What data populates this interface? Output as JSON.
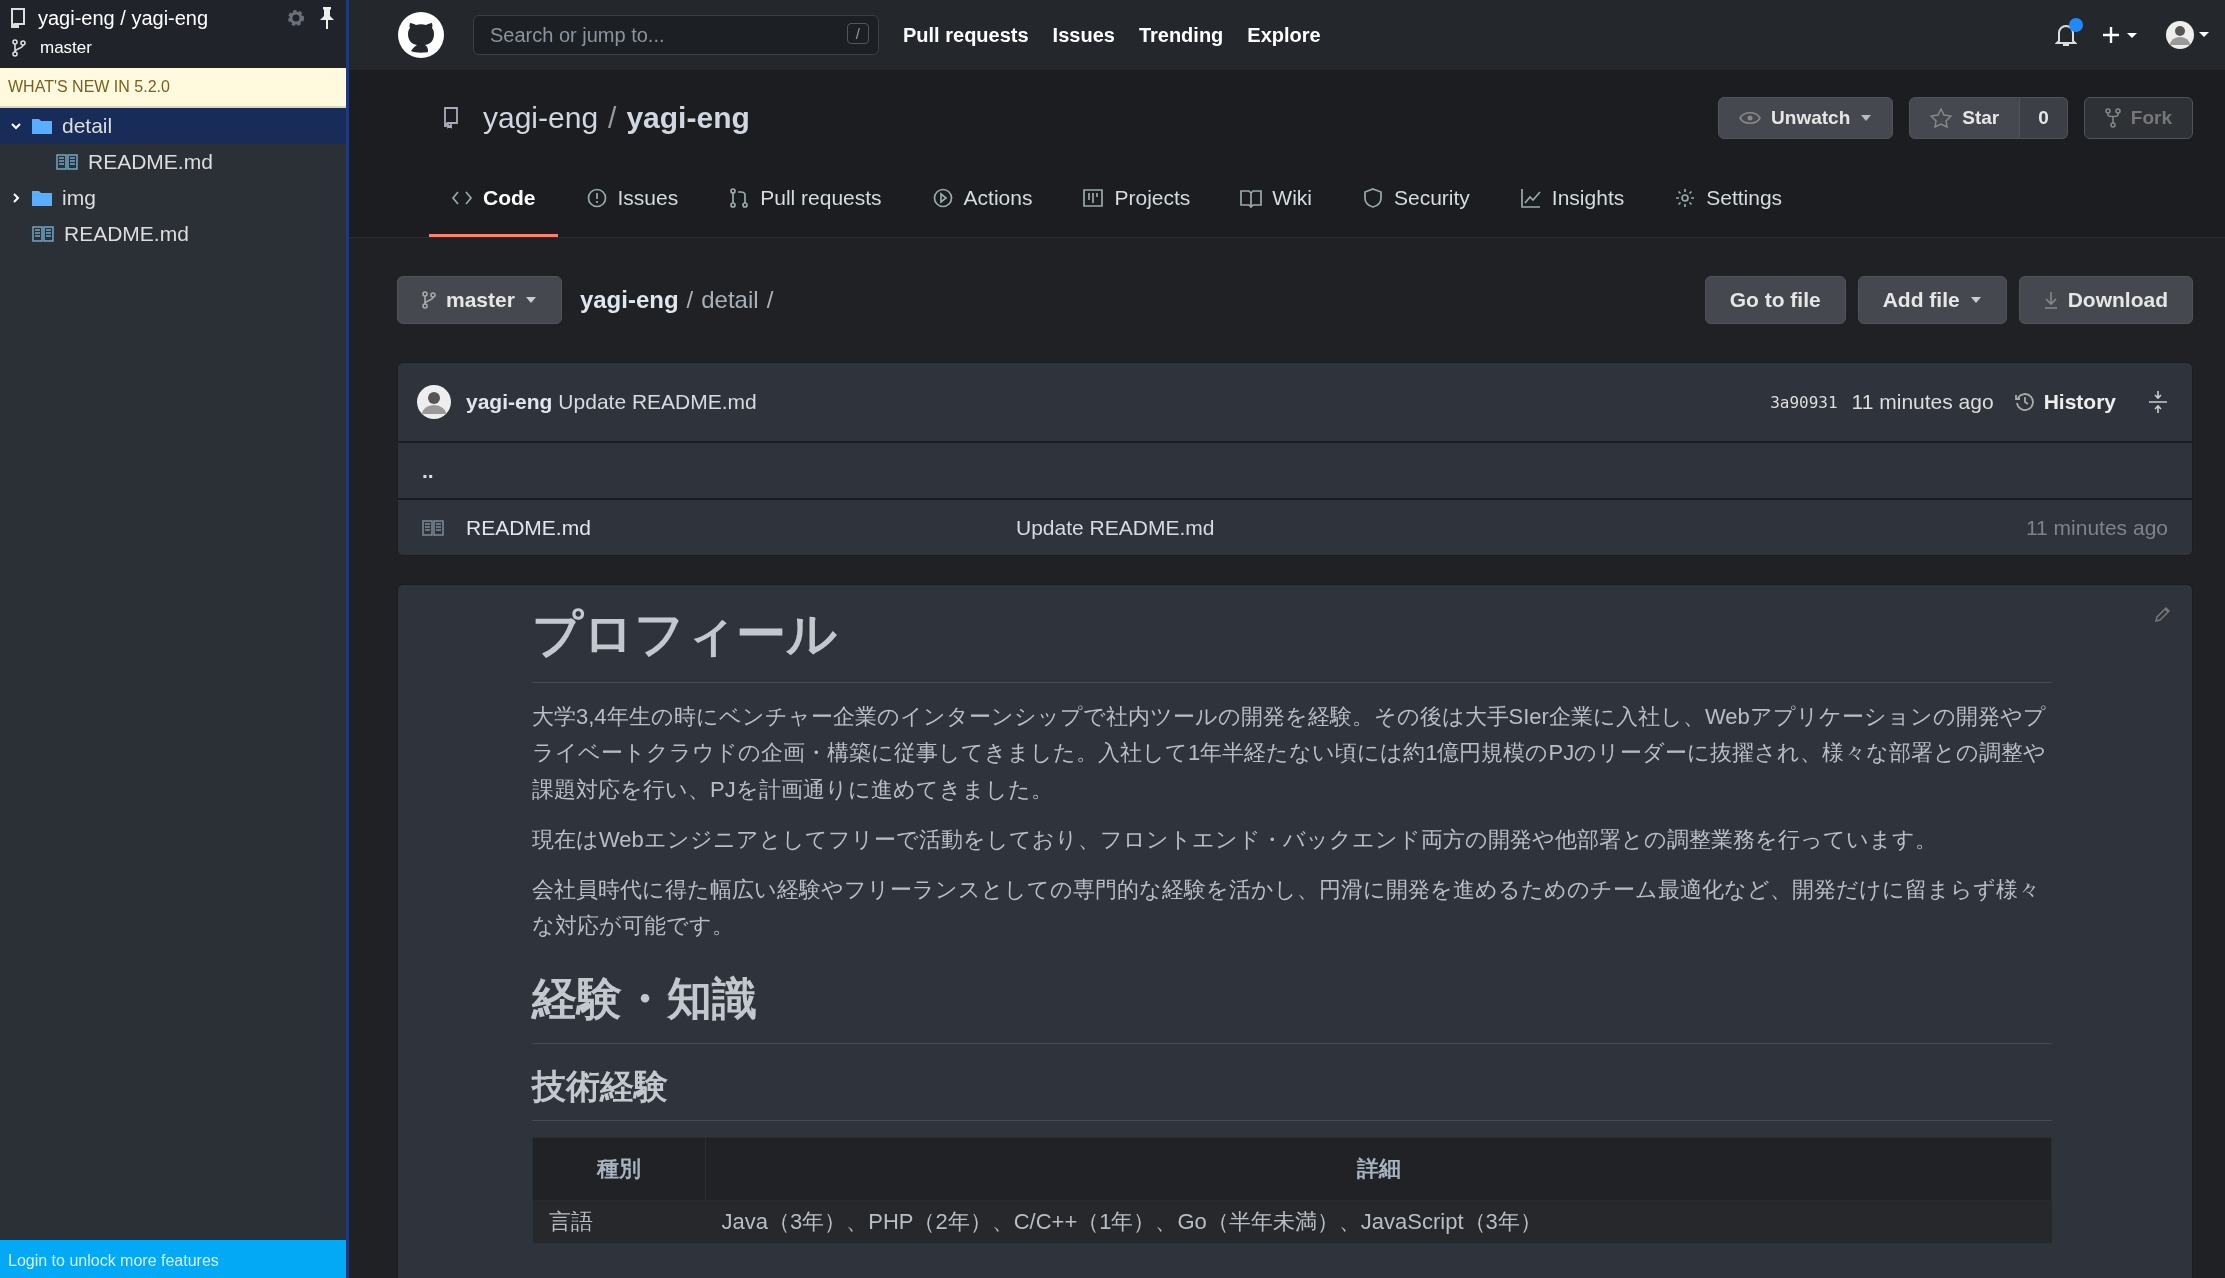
{
  "sidebar": {
    "repo_owner": "yagi-eng",
    "repo_separator": "/",
    "repo_name": "yagi-eng",
    "branch": "master",
    "banner": "WHAT'S NEW IN 5.2.0",
    "tree": [
      {
        "name": "detail",
        "kind": "folder",
        "expanded": true,
        "selected": true,
        "children": [
          {
            "name": "README.md",
            "kind": "file",
            "selected": false
          }
        ]
      },
      {
        "name": "img",
        "kind": "folder",
        "expanded": false,
        "selected": false
      },
      {
        "name": "README.md",
        "kind": "file",
        "selected": false
      }
    ],
    "footer": "Login to unlock more features"
  },
  "header": {
    "search": {
      "placeholder": "Search or jump to...",
      "key": "/"
    },
    "nav": [
      "Pull requests",
      "Issues",
      "Trending",
      "Explore"
    ],
    "notification_unread": true
  },
  "repo": {
    "owner": "yagi-eng",
    "separator": "/",
    "name": "yagi-eng",
    "watch": "Unwatch",
    "star": "Star",
    "star_count": "0",
    "fork": "Fork"
  },
  "tabs": [
    {
      "label": "Code",
      "selected": true
    },
    {
      "label": "Issues",
      "selected": false
    },
    {
      "label": "Pull requests",
      "selected": false
    },
    {
      "label": "Actions",
      "selected": false
    },
    {
      "label": "Projects",
      "selected": false
    },
    {
      "label": "Wiki",
      "selected": false
    },
    {
      "label": "Security",
      "selected": false
    },
    {
      "label": "Insights",
      "selected": false
    },
    {
      "label": "Settings",
      "selected": false
    }
  ],
  "file_nav": {
    "branch": "master",
    "breadcrumb": [
      {
        "text": "yagi-eng",
        "kind": "root"
      },
      {
        "text": "/",
        "kind": "separator"
      },
      {
        "text": "detail",
        "kind": "dir"
      },
      {
        "text": "/",
        "kind": "separator"
      }
    ],
    "buttons": [
      {
        "label": "Go to file",
        "kind": "plain"
      },
      {
        "label": "Add file",
        "kind": "dropdown"
      },
      {
        "label": "Download",
        "kind": "download"
      }
    ]
  },
  "commit": {
    "author": "yagi-eng",
    "message": "Update README.md",
    "sha": "3a90931",
    "time": "11 minutes ago",
    "history": "History"
  },
  "files": [
    {
      "name": "..",
      "kind": "parent"
    },
    {
      "name": "README.md",
      "kind": "file",
      "message": "Update README.md",
      "time": "11 minutes ago"
    }
  ],
  "readme": [
    {
      "kind": "h1",
      "text": "プロフィール"
    },
    {
      "kind": "p",
      "text": "大学3,4年生の時にベンチャー企業のインターンシップで社内ツールの開発を経験。その後は大手SIer企業に入社し、Webアプリケーションの開発やプライベートクラウドの企画・構築に従事してきました。入社して1年半経たない頃には約1億円規模のPJのリーダーに抜擢され、様々な部署との調整や課題対応を行い、PJを計画通りに進めてきました。"
    },
    {
      "kind": "p",
      "text": "現在はWebエンジニアとしてフリーで活動をしており、フロントエンド・バックエンド両方の開発や他部署との調整業務を行っています。"
    },
    {
      "kind": "p",
      "text": "会社員時代に得た幅広い経験やフリーランスとしての専門的な経験を活かし、円滑に開発を進めるためのチーム最適化など、開発だけに留まらず様々な対応が可能です。"
    },
    {
      "kind": "h2",
      "text": "経験・知識"
    },
    {
      "kind": "h3",
      "text": "技術経験"
    },
    {
      "kind": "table",
      "columns": [
        "種別",
        "詳細"
      ],
      "rows": [
        [
          "言語",
          "Java（3年）、PHP（2年）、C/C++（1年）、Go（半年未満）、JavaScript（3年）"
        ]
      ]
    }
  ]
}
